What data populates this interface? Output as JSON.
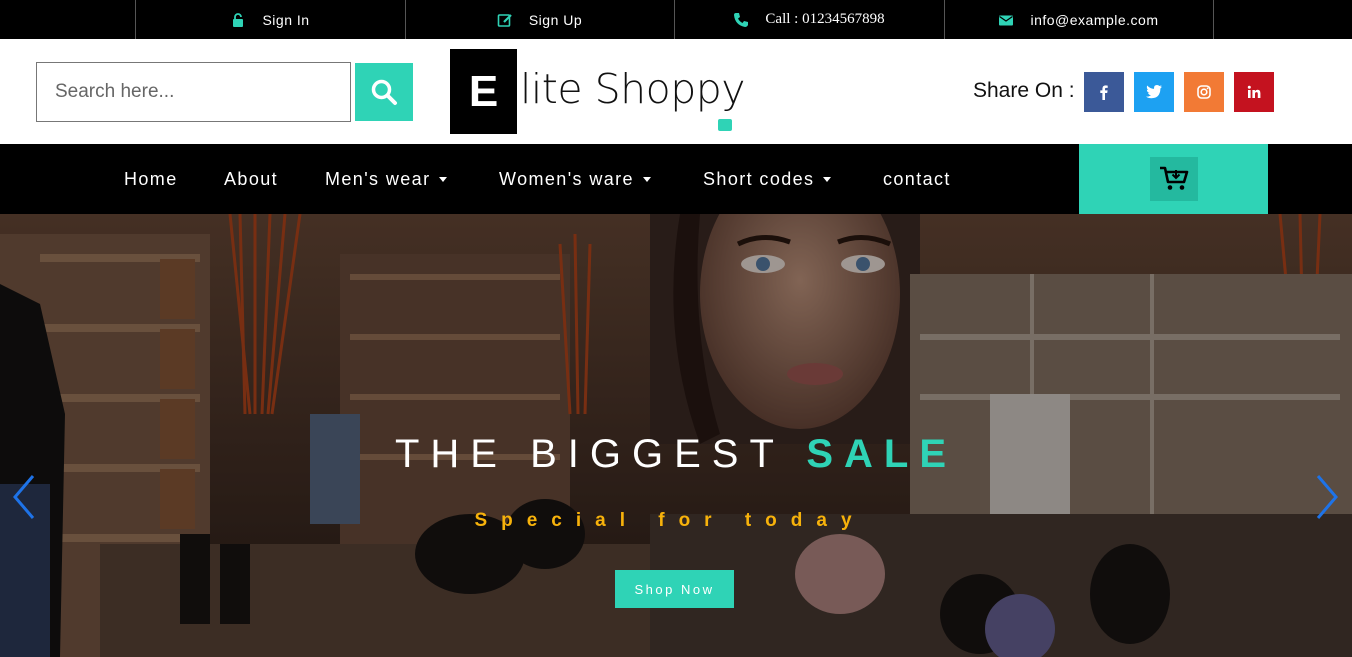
{
  "topbar": {
    "signin": {
      "label": "Sign In",
      "icon": "lock-icon"
    },
    "signup": {
      "label": "Sign Up",
      "icon": "edit-icon"
    },
    "call": {
      "label": "Call : 01234567898",
      "icon": "phone-icon"
    },
    "email": {
      "label": "info@example.com",
      "icon": "envelope-icon"
    }
  },
  "header": {
    "search": {
      "placeholder": "Search here..."
    },
    "logo": {
      "letter": "E",
      "text": "lite Shoppy"
    },
    "share_label": "Share On :",
    "social": [
      {
        "name": "facebook",
        "color": "#3b5998"
      },
      {
        "name": "twitter",
        "color": "#1da1f2"
      },
      {
        "name": "instagram",
        "color": "#f27a35"
      },
      {
        "name": "linkedin",
        "color": "#c4121f"
      }
    ]
  },
  "nav": {
    "items": [
      {
        "label": "Home",
        "dropdown": false
      },
      {
        "label": "About",
        "dropdown": false
      },
      {
        "label": "Men's wear",
        "dropdown": true
      },
      {
        "label": "Women's ware",
        "dropdown": true
      },
      {
        "label": "Short codes",
        "dropdown": true
      },
      {
        "label": "contact",
        "dropdown": false
      }
    ],
    "cart_icon": "cart-icon"
  },
  "hero": {
    "title_main": "THE BIGGEST ",
    "title_accent": "SALE",
    "subtitle": "Special for today",
    "button": "Shop Now"
  },
  "colors": {
    "accent": "#2fd3b6",
    "subtitle": "#f7b20b",
    "topbar": "#000000",
    "nav": "#000000"
  }
}
